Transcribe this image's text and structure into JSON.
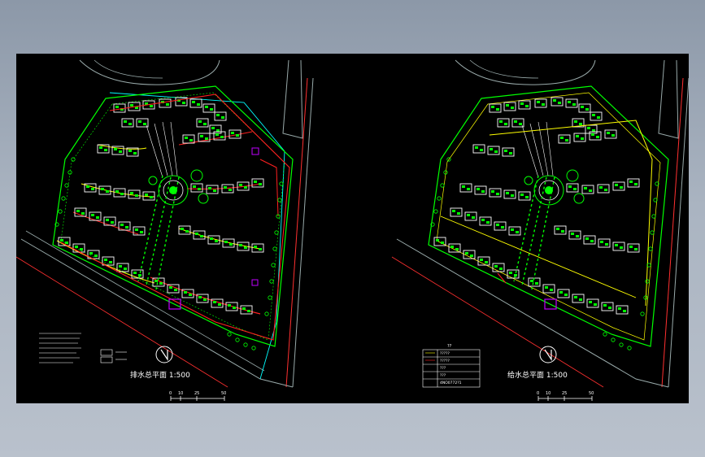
{
  "drawings": {
    "left": {
      "title": "排水总平面 1:500",
      "scale_ticks": [
        "0",
        "10",
        "25",
        "50"
      ]
    },
    "right": {
      "title": "给水总平面 1:500",
      "scale_ticks": [
        "0",
        "10",
        "25",
        "50"
      ],
      "legend_heading": "??",
      "legend_items": [
        "?????",
        "?????",
        "???",
        "???",
        "4NO0772?1"
      ]
    }
  },
  "colors": {
    "background": "#000000",
    "building_outline": "#ffffff",
    "landscape": "#00ff00",
    "drain_pipe": "#ff2020",
    "supply_pipe": "#ffff00",
    "road_edge": "#00ffff",
    "frame": "#c8c8c8"
  },
  "icons": [
    "north-arrow-icon"
  ]
}
